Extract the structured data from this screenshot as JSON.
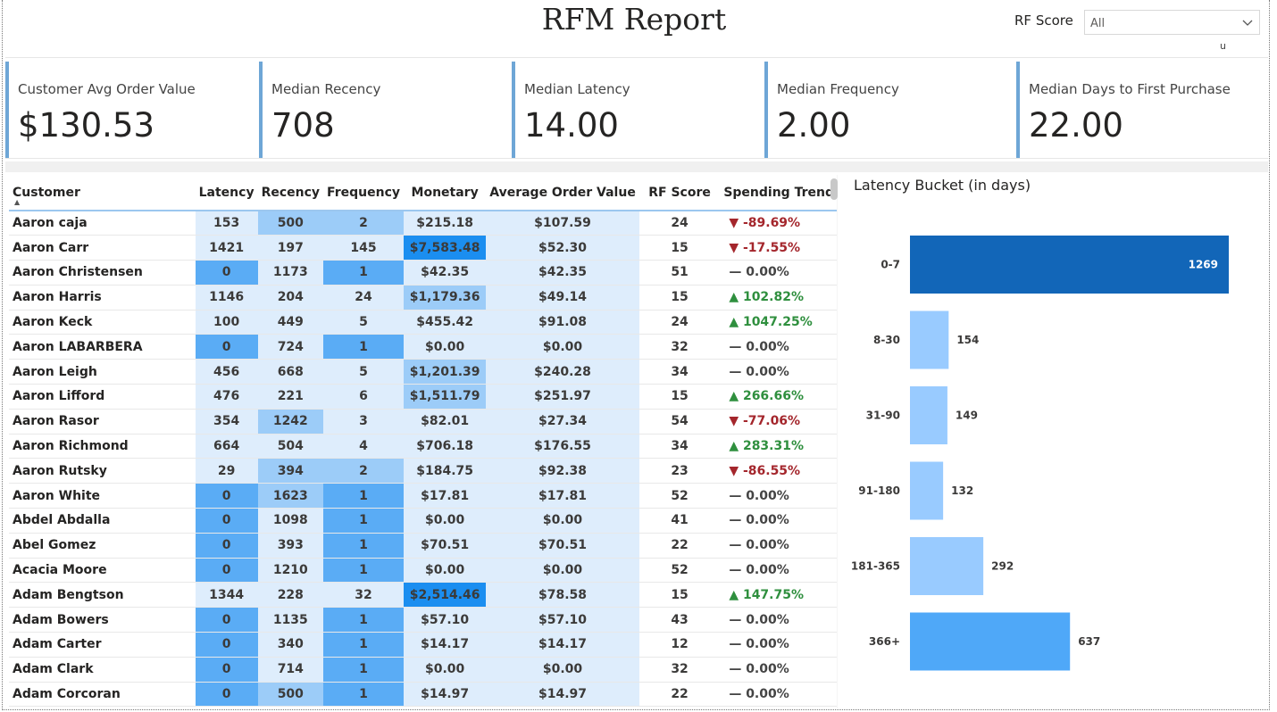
{
  "header": {
    "title": "RFM Report",
    "slicer_label": "RF Score",
    "slicer_value": "All",
    "tiny_mark": "u"
  },
  "cards": [
    {
      "label": "Customer Avg Order Value",
      "value": "$130.53"
    },
    {
      "label": "Median Recency",
      "value": "708"
    },
    {
      "label": "Median Latency",
      "value": "14.00"
    },
    {
      "label": "Median Frequency",
      "value": "2.00"
    },
    {
      "label": "Median Days to First Purchase",
      "value": "22.00"
    }
  ],
  "table": {
    "columns": [
      "Customer",
      "Latency",
      "Recency",
      "Frequency",
      "Monetary",
      "Average Order Value",
      "RF Score",
      "Spending Trend"
    ],
    "rows": [
      {
        "customer": "Aaron caja",
        "latency": "153",
        "recency": "500",
        "frequency": "2",
        "monetary": "$215.18",
        "aov": "$107.59",
        "rf": "24",
        "trend": "-89.69%",
        "dir": "down"
      },
      {
        "customer": "Aaron Carr",
        "latency": "1421",
        "recency": "197",
        "frequency": "145",
        "monetary": "$7,583.48",
        "aov": "$52.30",
        "rf": "15",
        "trend": "-17.55%",
        "dir": "down"
      },
      {
        "customer": "Aaron Christensen",
        "latency": "0",
        "recency": "1173",
        "frequency": "1",
        "monetary": "$42.35",
        "aov": "$42.35",
        "rf": "51",
        "trend": "0.00%",
        "dir": "flat"
      },
      {
        "customer": "Aaron Harris",
        "latency": "1146",
        "recency": "204",
        "frequency": "24",
        "monetary": "$1,179.36",
        "aov": "$49.14",
        "rf": "15",
        "trend": "102.82%",
        "dir": "up"
      },
      {
        "customer": "Aaron Keck",
        "latency": "100",
        "recency": "449",
        "frequency": "5",
        "monetary": "$455.42",
        "aov": "$91.08",
        "rf": "24",
        "trend": "1047.25%",
        "dir": "up"
      },
      {
        "customer": "Aaron LABARBERA",
        "latency": "0",
        "recency": "724",
        "frequency": "1",
        "monetary": "$0.00",
        "aov": "$0.00",
        "rf": "32",
        "trend": "0.00%",
        "dir": "flat"
      },
      {
        "customer": "Aaron Leigh",
        "latency": "456",
        "recency": "668",
        "frequency": "5",
        "monetary": "$1,201.39",
        "aov": "$240.28",
        "rf": "34",
        "trend": "0.00%",
        "dir": "flat"
      },
      {
        "customer": "Aaron Lifford",
        "latency": "476",
        "recency": "221",
        "frequency": "6",
        "monetary": "$1,511.79",
        "aov": "$251.97",
        "rf": "15",
        "trend": "266.66%",
        "dir": "up"
      },
      {
        "customer": "Aaron Rasor",
        "latency": "354",
        "recency": "1242",
        "frequency": "3",
        "monetary": "$82.01",
        "aov": "$27.34",
        "rf": "54",
        "trend": "-77.06%",
        "dir": "down"
      },
      {
        "customer": "Aaron Richmond",
        "latency": "664",
        "recency": "504",
        "frequency": "4",
        "monetary": "$706.18",
        "aov": "$176.55",
        "rf": "34",
        "trend": "283.31%",
        "dir": "up"
      },
      {
        "customer": "Aaron Rutsky",
        "latency": "29",
        "recency": "394",
        "frequency": "2",
        "monetary": "$184.75",
        "aov": "$92.38",
        "rf": "23",
        "trend": "-86.55%",
        "dir": "down"
      },
      {
        "customer": "Aaron White",
        "latency": "0",
        "recency": "1623",
        "frequency": "1",
        "monetary": "$17.81",
        "aov": "$17.81",
        "rf": "52",
        "trend": "0.00%",
        "dir": "flat"
      },
      {
        "customer": "Abdel Abdalla",
        "latency": "0",
        "recency": "1098",
        "frequency": "1",
        "monetary": "$0.00",
        "aov": "$0.00",
        "rf": "41",
        "trend": "0.00%",
        "dir": "flat"
      },
      {
        "customer": "Abel Gomez",
        "latency": "0",
        "recency": "393",
        "frequency": "1",
        "monetary": "$70.51",
        "aov": "$70.51",
        "rf": "22",
        "trend": "0.00%",
        "dir": "flat"
      },
      {
        "customer": "Acacia Moore",
        "latency": "0",
        "recency": "1210",
        "frequency": "1",
        "monetary": "$0.00",
        "aov": "$0.00",
        "rf": "52",
        "trend": "0.00%",
        "dir": "flat"
      },
      {
        "customer": "Adam Bengtson",
        "latency": "1344",
        "recency": "228",
        "frequency": "32",
        "monetary": "$2,514.46",
        "aov": "$78.58",
        "rf": "15",
        "trend": "147.75%",
        "dir": "up"
      },
      {
        "customer": "Adam Bowers",
        "latency": "0",
        "recency": "1135",
        "frequency": "1",
        "monetary": "$57.10",
        "aov": "$57.10",
        "rf": "43",
        "trend": "0.00%",
        "dir": "flat"
      },
      {
        "customer": "Adam Carter",
        "latency": "0",
        "recency": "340",
        "frequency": "1",
        "monetary": "$14.17",
        "aov": "$14.17",
        "rf": "12",
        "trend": "0.00%",
        "dir": "flat"
      },
      {
        "customer": "Adam Clark",
        "latency": "0",
        "recency": "714",
        "frequency": "1",
        "monetary": "$0.00",
        "aov": "$0.00",
        "rf": "32",
        "trend": "0.00%",
        "dir": "flat"
      },
      {
        "customer": "Adam Corcoran",
        "latency": "0",
        "recency": "500",
        "frequency": "1",
        "monetary": "$14.97",
        "aov": "$14.97",
        "rf": "22",
        "trend": "0.00%",
        "dir": "flat"
      }
    ]
  },
  "colors": {
    "cell_light": "#deedfc",
    "cell_mid": "#9cccf8",
    "cell_strong": "#5aacf5",
    "cell_max": "#1b8ef0",
    "bar_dark": "#1266b8",
    "bar_light": "#99cbff",
    "bar_mid": "#4fa8f8",
    "up": "#2f8f3e",
    "down": "#a4262c"
  },
  "chart_data": {
    "type": "bar",
    "orientation": "horizontal",
    "title": "Latency Bucket (in days)",
    "categories": [
      "0-7",
      "8-30",
      "31-90",
      "91-180",
      "181-365",
      "366+"
    ],
    "values": [
      1269,
      154,
      149,
      132,
      292,
      637
    ],
    "xlabel": "",
    "ylabel": ""
  }
}
